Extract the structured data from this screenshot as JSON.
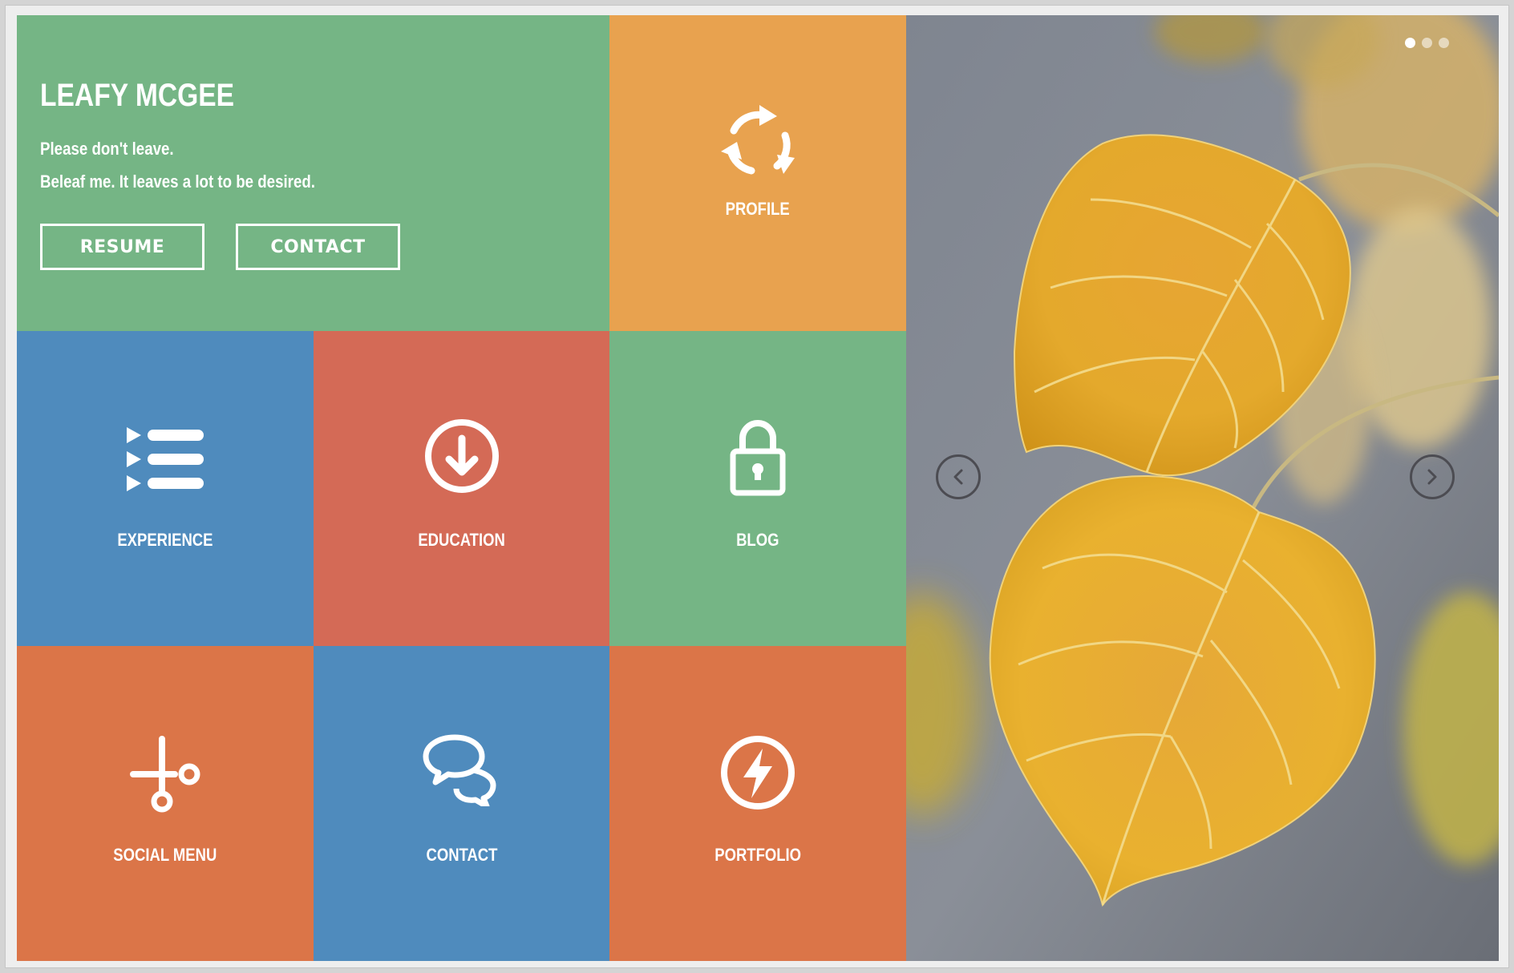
{
  "hero": {
    "title": "LEAFY MCGEE",
    "line1": "Please don't leave.",
    "line2": "Beleaf me. It leaves a lot to be desired.",
    "resume_label": "RESUME",
    "contact_label": "CONTACT"
  },
  "tiles": [
    {
      "label": "PROFILE",
      "icon": "refresh-icon",
      "color": "#e8a24f"
    },
    {
      "label": "EXPERIENCE",
      "icon": "list-icon",
      "color": "#4f8bbd"
    },
    {
      "label": "EDUCATION",
      "icon": "download-icon",
      "color": "#d46a56"
    },
    {
      "label": "BLOG",
      "icon": "lock-icon",
      "color": "#75b585"
    },
    {
      "label": "SOCIAL MENU",
      "icon": "scissors-icon",
      "color": "#db7548"
    },
    {
      "label": "CONTACT",
      "icon": "chat-icon",
      "color": "#4f8bbd"
    },
    {
      "label": "PORTFOLIO",
      "icon": "bolt-icon",
      "color": "#db7548"
    }
  ],
  "slider": {
    "slide_count": 3,
    "active_index": 0,
    "image": "yellow-aspen-leaves"
  }
}
